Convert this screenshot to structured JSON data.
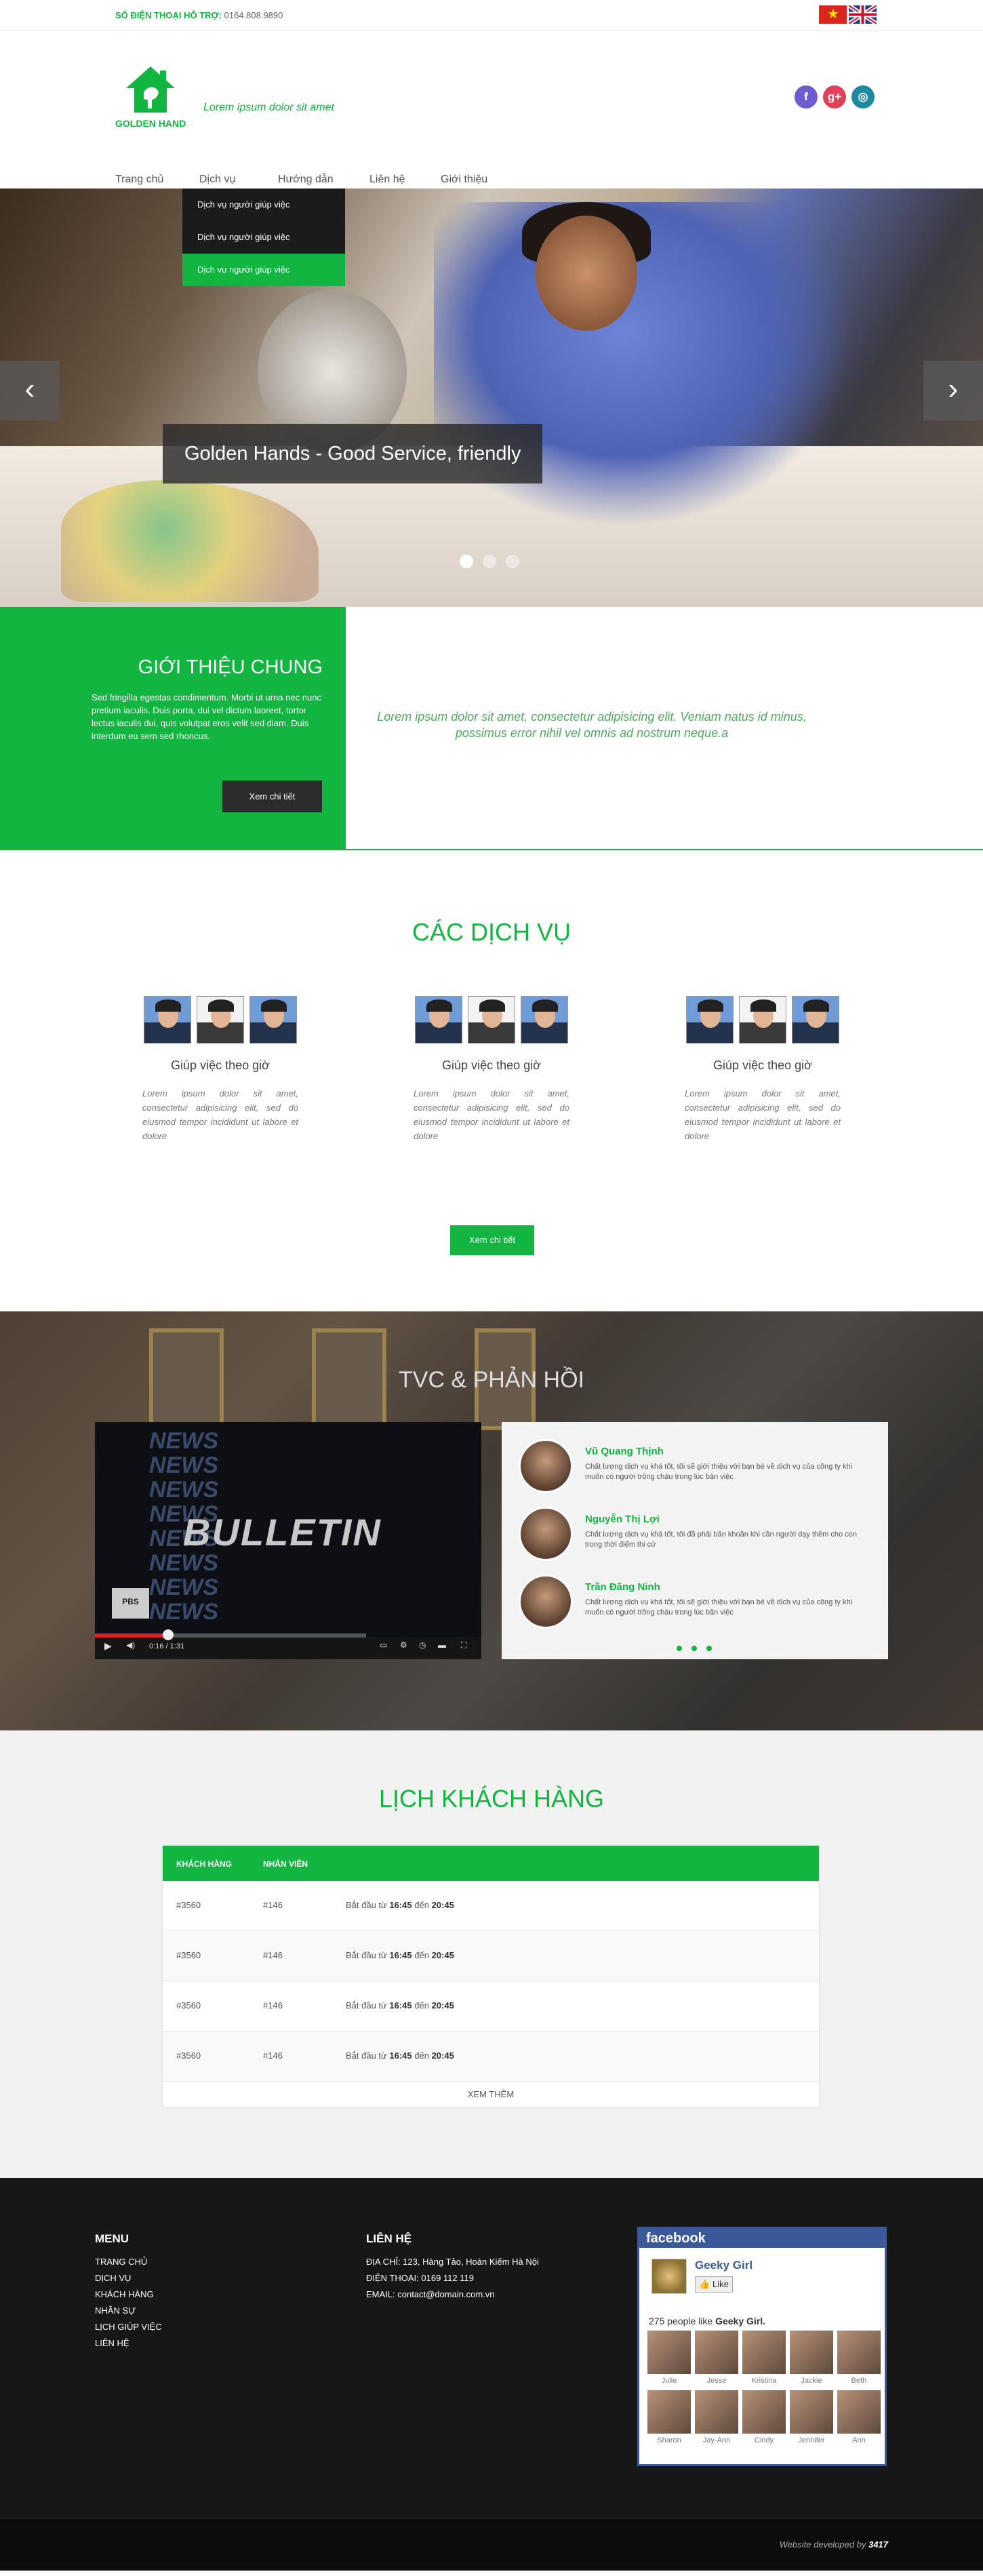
{
  "topbar": {
    "phone_label": "SỐ ĐIỆN THOẠI HỖ TRỢ:",
    "phone_number": "0164.808.9890"
  },
  "header": {
    "logo_name": "GOLDEN HAND",
    "tagline": "Lorem ipsum dolor sit amet"
  },
  "nav": {
    "items": [
      "Trang chủ",
      "Dịch vụ",
      "Hướng dẫn",
      "Liên hệ",
      "Giới thiệu"
    ]
  },
  "dropdown": {
    "items": [
      "Dịch vụ người giúp việc",
      "Dịch vụ người giúp việc",
      "Dịch vụ người giúp việc"
    ]
  },
  "hero": {
    "caption": "Golden Hands - Good Service, friendly",
    "prev": "‹",
    "next": "›",
    "slide_count": 3,
    "active_slide": 1
  },
  "intro": {
    "title": "GIỚI THIỆU CHUNG",
    "text": "Sed fringilla egestas condimentum. Morbi ut urna nec nunc pretium iaculis. Duis porta, dui vel dictum laoreet, tortor lectus iaculis dui, quis volutpat eros velit sed diam. Duis interdum eu sem sed rhoncus.",
    "button": "Xem chi tiết",
    "quote": "Lorem ipsum dolor sit amet, consectetur adipisicing elit. Veniam natus id minus, possimus error nihil vel omnis ad nostrum neque.a"
  },
  "services": {
    "title": "CÁC DỊCH VỤ",
    "items": [
      {
        "title": "Giúp việc theo giờ",
        "text": "Lorem ipsum dolor sit amet, consectetur adipisicing elit, sed do eiusmod tempor incididunt ut labore et dolore"
      },
      {
        "title": "Giúp việc theo giờ",
        "text": "Lorem ipsum dolor sit amet, consectetur adipisicing elit, sed do eiusmod tempor incididunt ut labore et dolore"
      },
      {
        "title": "Giúp việc theo giờ",
        "text": "Lorem ipsum dolor sit amet, consectetur adipisicing elit, sed do eiusmod tempor incididunt ut labore et dolore"
      }
    ],
    "button": "Xem chi tiết"
  },
  "tvc": {
    "title": "TVC & PHẢN HỒI",
    "video_text": "BULLETIN",
    "video_logo": "PBS",
    "video_time": "0:16 / 1:31",
    "reviews": [
      {
        "name": "Vũ Quang Thịnh",
        "text": "Chất lượng dịch vụ khá tốt, tôi sẽ giới thiệu với bạn bè về dịch vụ của công ty khi muốn có người trông cháu trong lúc bận việc"
      },
      {
        "name": "Nguyễn Thị Lợi",
        "text": "Chất lượng dịch vụ khá tốt, tôi đã phải băn khoăn khi cần người dạy thêm cho con trong thời điểm thi cử"
      },
      {
        "name": "Trần Đăng Ninh",
        "text": "Chất lượng dịch vụ khá tốt, tôi sẽ giới thiệu với bạn bè về dịch vụ của công ty khi muốn có người trông cháu trong lúc bận việc"
      }
    ]
  },
  "schedule": {
    "title": "LỊCH KHÁCH HÀNG",
    "headers": [
      "KHÁCH HÀNG",
      "NHÂN VIÊN"
    ],
    "rows": [
      {
        "client": "#3560",
        "staff": "#146",
        "prefix": "Bắt đầu từ",
        "start": "16:45",
        "mid": "đến",
        "end": "20:45"
      },
      {
        "client": "#3560",
        "staff": "#146",
        "prefix": "Bắt đầu từ",
        "start": "16:45",
        "mid": "đến",
        "end": "20:45"
      },
      {
        "client": "#3560",
        "staff": "#146",
        "prefix": "Bắt đầu từ",
        "start": "16:45",
        "mid": "đến",
        "end": "20:45"
      },
      {
        "client": "#3560",
        "staff": "#146",
        "prefix": "Bắt đầu từ",
        "start": "16:45",
        "mid": "đến",
        "end": "20:45"
      }
    ],
    "more": "XEM THÊM"
  },
  "footer": {
    "menu_title": "MENU",
    "menu": [
      "TRANG CHỦ",
      "DỊCH VỤ",
      "KHÁCH HÀNG",
      "NHÂN SỰ",
      "LỊCH GIÚP VIỆC",
      "LIÊN HỆ"
    ],
    "contact_title": "LIÊN HỆ",
    "address": "ĐỊA CHỈ:  123, Hàng Tảo, Hoàn Kiếm Hà Nội",
    "phone": "ĐIỆN THOẠI:  0169 112 119",
    "email": "EMAIL:  contact@domain.com.vn",
    "facebook": {
      "brand": "facebook",
      "page": "Geeky Girl",
      "like": "Like",
      "count_text": "275 people like",
      "count_page": "Geeky Girl.",
      "friends": [
        "Julie",
        "Jesse",
        "Kristina",
        "Jackie",
        "Beth",
        "Sharon",
        "Jay-Ann",
        "Cindy",
        "Jennifer",
        "Ann"
      ]
    }
  },
  "bottom": {
    "credit": "Website developed by",
    "credit_by": "3417"
  },
  "colors": {
    "accent": "#12b540",
    "dark": "#1b1b1b"
  }
}
